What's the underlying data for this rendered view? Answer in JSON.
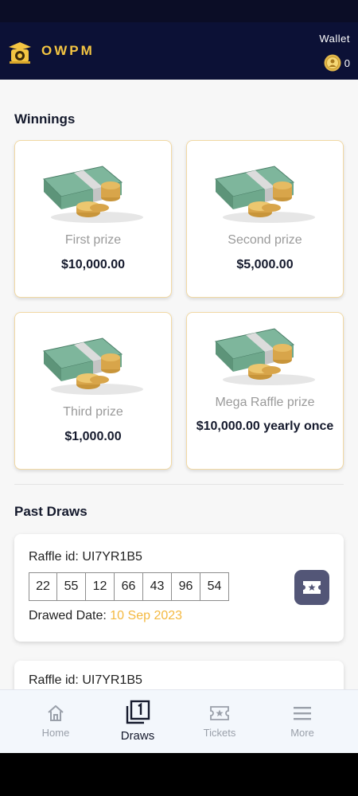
{
  "header": {
    "brand": "OWPM",
    "wallet_label": "Wallet",
    "wallet_amount": "0",
    "brand_color": "#f4c542",
    "bg_color": "#0c1136"
  },
  "winnings": {
    "title": "Winnings",
    "prizes": [
      {
        "name": "First prize",
        "amount": "$10,000.00"
      },
      {
        "name": "Second prize",
        "amount": "$5,000.00"
      },
      {
        "name": "Third prize",
        "amount": "$1,000.00"
      },
      {
        "name": "Mega Raffle prize",
        "amount": "$10,000.00 yearly once"
      }
    ]
  },
  "past_draws": {
    "title": "Past Draws",
    "raffle_id_label": "Raffle id:",
    "drawed_date_label": "Drawed Date:",
    "draws": [
      {
        "raffle_id": "UI7YR1B5",
        "numbers": [
          "22",
          "55",
          "12",
          "66",
          "43",
          "96",
          "54"
        ],
        "date": "10 Sep 2023"
      },
      {
        "raffle_id": "UI7YR1B5"
      }
    ]
  },
  "nav": {
    "items": [
      {
        "label": "Home",
        "icon": "home-icon"
      },
      {
        "label": "Draws",
        "icon": "draws-icon",
        "active": true
      },
      {
        "label": "Tickets",
        "icon": "ticket-icon"
      },
      {
        "label": "More",
        "icon": "menu-icon"
      }
    ]
  }
}
